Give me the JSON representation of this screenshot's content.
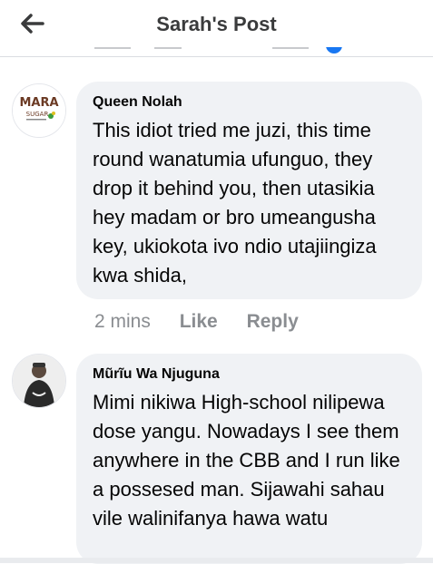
{
  "header": {
    "title": "Sarah's Post"
  },
  "comments": [
    {
      "author": "Queen Nolah",
      "avatar_text": {
        "line1": "MARA",
        "line2": "SUGAR"
      },
      "text": "This idiot tried me juzi, this time round wanatumia ufunguo, they drop it behind you, then utasikia hey madam or bro umeangusha key, ukiokota ivo ndio utajiingiza kwa shida,",
      "time": "2 mins",
      "like_label": "Like",
      "reply_label": "Reply"
    },
    {
      "author": "Mũrĩu Wa Njuguna",
      "text": "Mimi nikiwa High-school nilipewa dose yangu. Nowadays I see them anywhere in the CBB and I run like a possesed man. Sijawahi sahau vile walinifanya hawa watu"
    }
  ],
  "colors": {
    "bubble": "#f0f2f5",
    "meta": "#8a8d91",
    "title": "#3a3b3c",
    "brand_blue": "#1877f2"
  }
}
